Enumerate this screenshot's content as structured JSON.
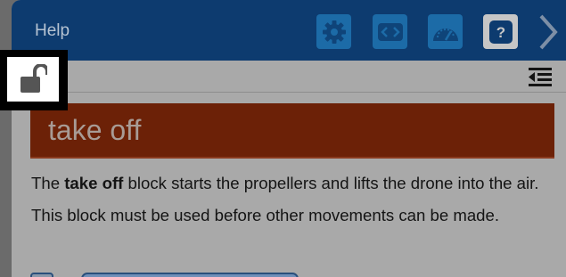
{
  "header": {
    "title": "Help",
    "buttons": [
      {
        "name": "settings",
        "icon": "gear-icon"
      },
      {
        "name": "code",
        "icon": "code-brackets-icon"
      },
      {
        "name": "dashboard",
        "icon": "speedometer-icon"
      },
      {
        "name": "help",
        "icon": "question-icon"
      },
      {
        "name": "collapse",
        "icon": "chevron-right-icon"
      }
    ]
  },
  "help_content": {
    "block_title": "take off",
    "description": {
      "prefix": "The ",
      "bold": "take off",
      "suffix": " block starts the propellers and lifts the drone into the air. This block must be used before other movements can be made."
    }
  },
  "icons": {
    "lock": "unlocked-padlock-icon",
    "outdent": "outdent-icon"
  },
  "colors": {
    "header": "#0d3b6f",
    "button_blue": "#1c6ba7",
    "title_bar": "#6c2107",
    "panel": "#a9a9a9"
  }
}
